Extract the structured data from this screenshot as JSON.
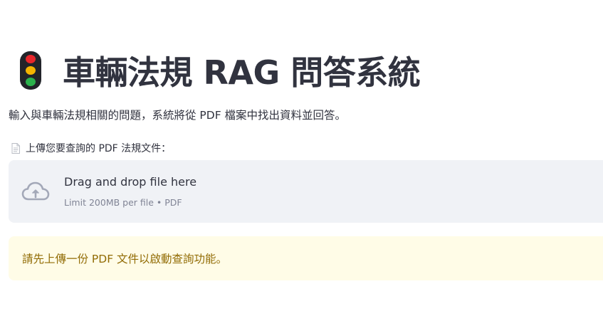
{
  "header": {
    "icon": "traffic-light-icon",
    "title": "車輛法規 RAG 問答系統"
  },
  "description": "輸入與車輛法規相關的問題，系統將從 PDF 檔案中找出資料並回答。",
  "uploader": {
    "icon": "document-icon",
    "label": "上傳您要查詢的 PDF 法規文件：",
    "dropzone_icon": "cloud-upload-icon",
    "dropzone_title": "Drag and drop file here",
    "dropzone_hint": "Limit 200MB per file • PDF"
  },
  "alert": {
    "type": "warning",
    "text": "請先上傳一份 PDF 文件以啟動查詢功能。"
  },
  "colors": {
    "text": "#31333f",
    "dropzone_bg": "#f0f2f6",
    "alert_bg": "#fffce7",
    "alert_text": "#926c05",
    "lamp_red": "#e8262b",
    "lamp_yellow": "#f4b400",
    "lamp_green": "#2bb24c"
  }
}
